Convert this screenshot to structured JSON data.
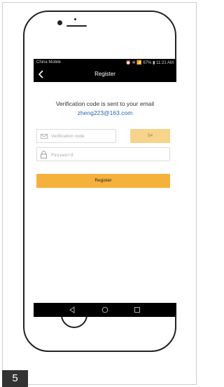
{
  "status_bar": {
    "carrier": "China Mobile",
    "right": "⏰ ✲ 📶 67% ▮ 11:21 AM"
  },
  "nav": {
    "title": "Register",
    "back_icon": "chevron-left-icon"
  },
  "message": {
    "line": "Verification code is sent to your email",
    "email": "zheng223@163.com"
  },
  "form": {
    "code_placeholder": "Verification code",
    "code_value": "",
    "countdown": "54",
    "password_placeholder": "Password",
    "password_value": "",
    "submit_label": "Register"
  },
  "system_nav": [
    "back-triangle-icon",
    "home-circle-icon",
    "recent-square-icon"
  ],
  "figure": {
    "page_number": "5"
  },
  "colors": {
    "accent": "#f5b13c",
    "countdown_bg": "#f6d48c",
    "email_link": "#2a66b0",
    "bar_bg": "#000000"
  }
}
